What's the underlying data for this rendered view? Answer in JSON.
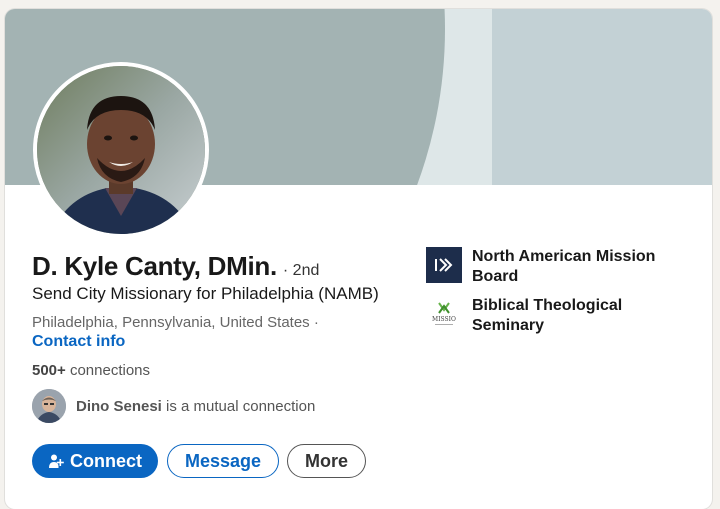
{
  "profile": {
    "name": "D. Kyle Canty, DMin.",
    "degree": "· 2nd",
    "headline": "Send City Missionary for Philadelphia (NAMB)",
    "location": "Philadelphia, Pennsylvania, United States ·",
    "contact_info": "Contact info",
    "connections_count": "500+",
    "connections_label": "connections",
    "mutual_name": "Dino Senesi",
    "mutual_text": "is a mutual connection"
  },
  "actions": {
    "connect_label": "Connect",
    "message_label": "Message",
    "more_label": "More"
  },
  "organizations": [
    {
      "name": "North American Mission Board",
      "logo_icon": "namb-logo"
    },
    {
      "name": "Biblical Theological Seminary",
      "logo_icon": "missio-logo",
      "logo_text": "MISSIO"
    }
  ],
  "colors": {
    "accent": "#0a66c2",
    "banner_light": "#c3d1d5",
    "banner_dark": "#a3b3b3",
    "namb_logo_bg": "#1d2d4b"
  }
}
